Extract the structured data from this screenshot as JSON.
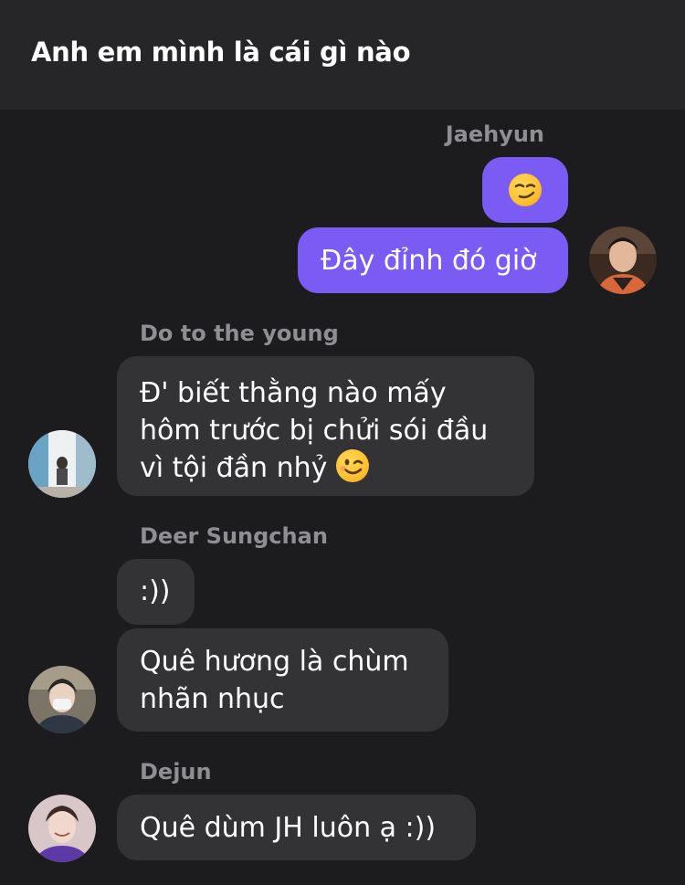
{
  "header": {
    "title": "Anh em mình là cái gì nào"
  },
  "messages": {
    "jaehyun": {
      "sender": "Jaehyun",
      "emoji_bubble": "smirking-face-emoji",
      "text": "Đây đỉnh đó giờ"
    },
    "doyoung": {
      "sender": "Do to the young",
      "lines": [
        "Đ' biết thằng nào mấy",
        "hôm trước bị chửi sói đầu",
        "vì tội đần nhỷ"
      ],
      "trailing_emoji": "winking-face-emoji"
    },
    "sungchan": {
      "sender": "Deer Sungchan",
      "text1": ":))",
      "lines2": [
        "Quê hương là chùm",
        "nhãn nhục"
      ]
    },
    "dejun": {
      "sender": "Dejun",
      "text": "Quê dùm JH luôn ạ :))"
    }
  },
  "colors": {
    "background": "#1c1c1e",
    "header": "#262628",
    "outgoing_bubble": "#7a5cf5",
    "incoming_bubble": "#333335",
    "sender_name": "#8e8e93"
  }
}
